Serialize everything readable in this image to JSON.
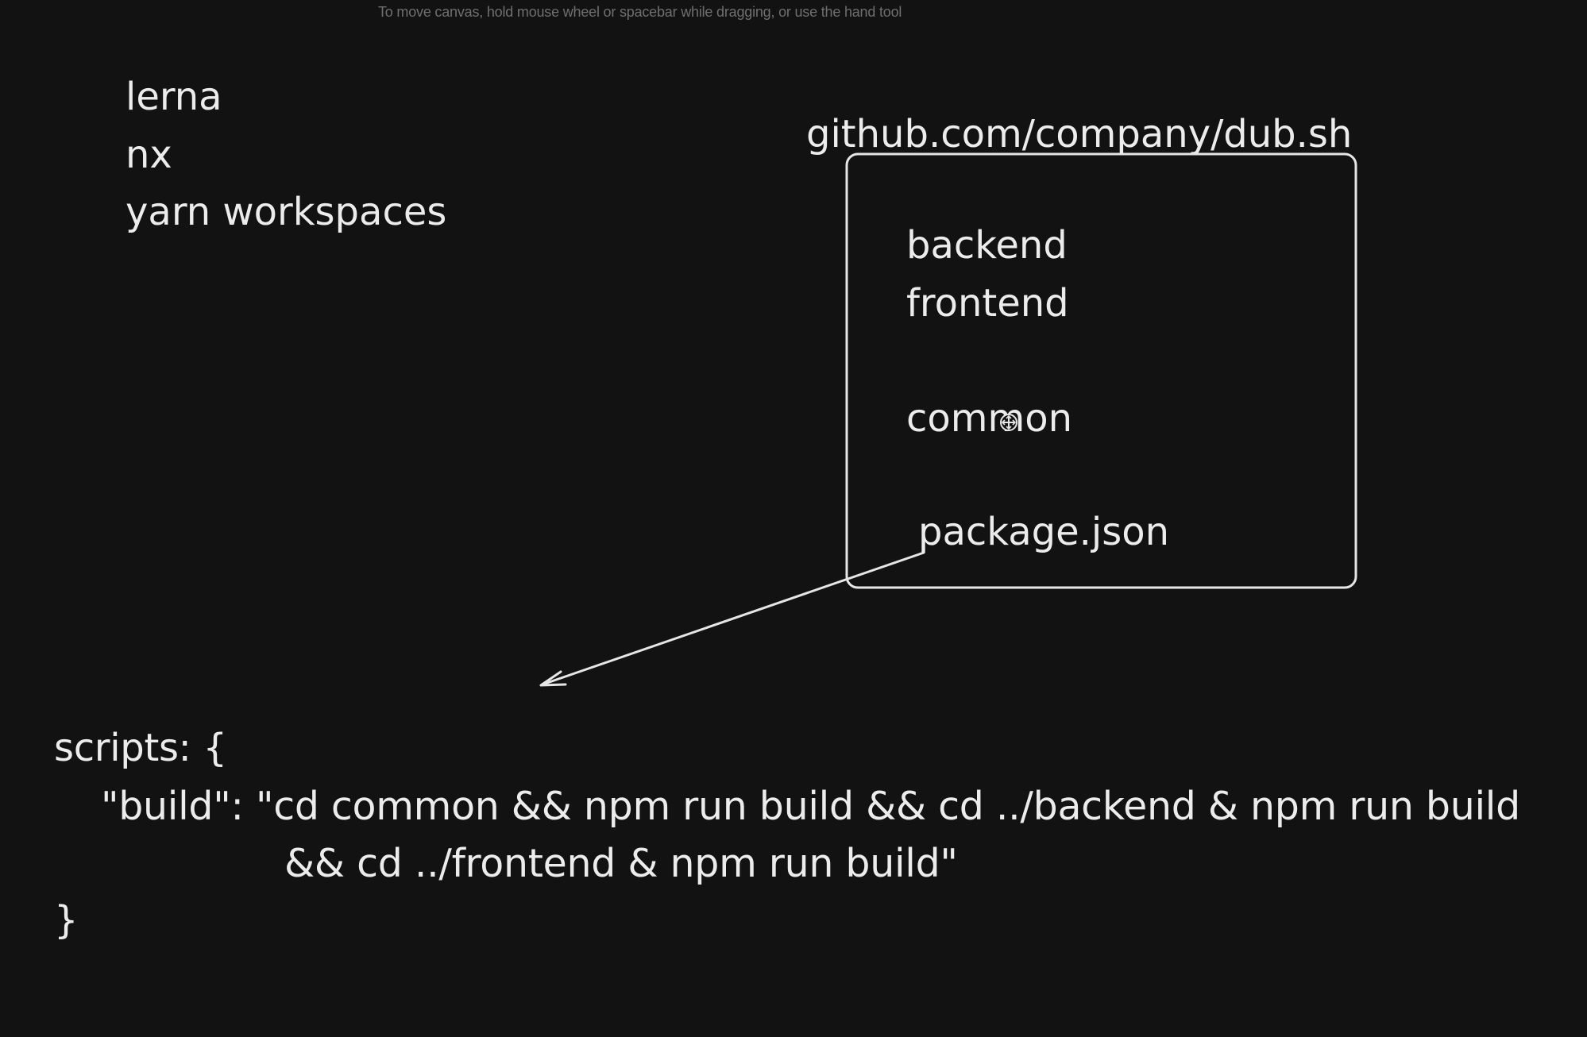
{
  "hint": "To move canvas, hold mouse wheel or spacebar while dragging, or use the hand tool",
  "tools_list": [
    "lerna",
    "nx",
    "yarn workspaces"
  ],
  "repo": {
    "url": "github.com/company/dub.sh",
    "folders": [
      "backend",
      "frontend",
      "common"
    ],
    "file": "package.json"
  },
  "code": {
    "line1": "scripts: {",
    "line2": "\"build\": \"cd common && npm run build && cd ../backend & npm run build",
    "line3": "&& cd ../frontend & npm run build\"",
    "line4": "}"
  },
  "icons": {
    "cursor": "move-cursor-icon"
  },
  "colors": {
    "background": "#121212",
    "stroke": "#e6e6e6",
    "text": "#ececec"
  }
}
